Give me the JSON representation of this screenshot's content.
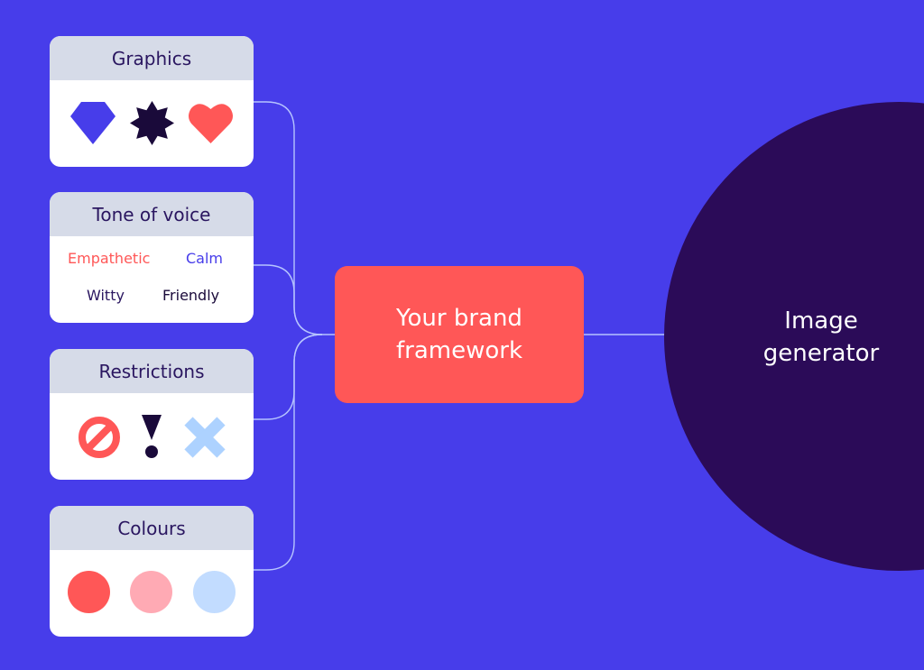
{
  "cards": {
    "graphics": {
      "title": "Graphics",
      "icons": [
        "diamond-icon",
        "star-burst-icon",
        "heart-icon"
      ]
    },
    "tone": {
      "title": "Tone of voice",
      "words": [
        {
          "text": "Empathetic",
          "color": "#ff5757"
        },
        {
          "text": "Calm",
          "color": "#473dea"
        },
        {
          "text": "Witty",
          "color": "#2a1660"
        },
        {
          "text": "Friendly",
          "color": "#1a0a3a"
        }
      ]
    },
    "restrictions": {
      "title": "Restrictions",
      "icons": [
        "prohibited-icon",
        "exclamation-icon",
        "cross-icon"
      ]
    },
    "colours": {
      "title": "Colours",
      "swatches": [
        "#ff5757",
        "#ffaab4",
        "#c2dcff"
      ]
    }
  },
  "center": {
    "line1": "Your brand",
    "line2": "framework"
  },
  "output": {
    "line1": "Image",
    "line2": "generator"
  },
  "palette": {
    "background": "#473dea",
    "brand": "#ff5757",
    "dark": "#2b0b58",
    "header": "#d6dbe8"
  }
}
